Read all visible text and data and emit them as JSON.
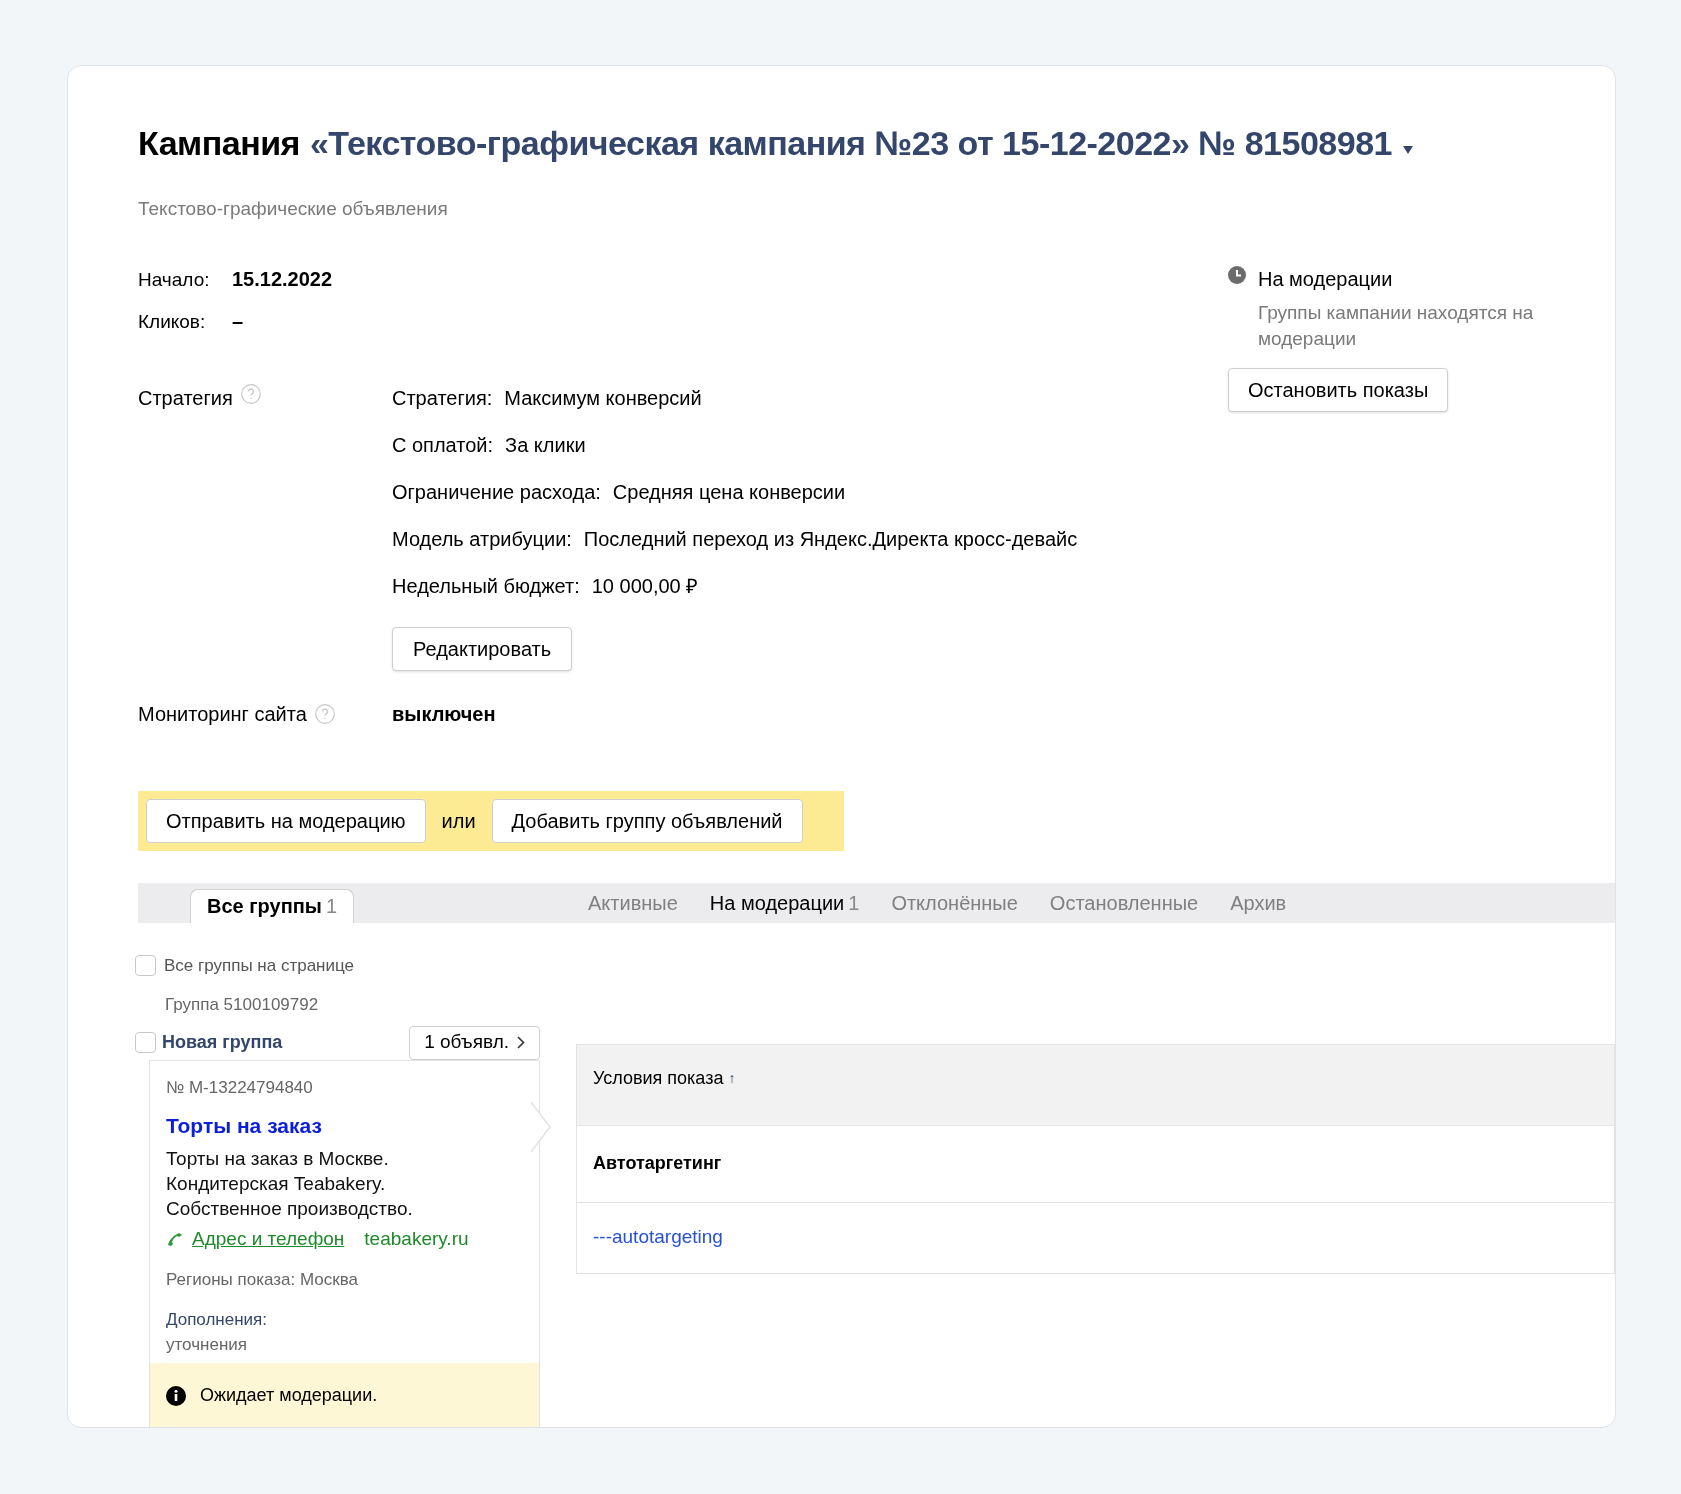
{
  "header": {
    "title_prefix": "Кампания",
    "title_name": "«Текстово-графическая кампания №23 от 15-12-2022» № 81508981",
    "subtitle": "Текстово-графические объявления"
  },
  "facts": [
    {
      "label": "Начало:",
      "value": "15.12.2022"
    },
    {
      "label": "Кликов:",
      "value": "–"
    }
  ],
  "status": {
    "title": "На модерации",
    "description": "Группы кампании находятся на модерации",
    "button": "Остановить показы"
  },
  "strategy": {
    "label": "Стратегия",
    "rows": [
      {
        "label": "Стратегия:",
        "value": "Максимум конверсий"
      },
      {
        "label": "С оплатой:",
        "value": "За клики"
      },
      {
        "label": "Ограничение расхода:",
        "value": "Средняя цена конверсии"
      },
      {
        "label": "Модель атрибуции:",
        "value": "Последний переход из Яндекс.Директа кросс-девайс"
      },
      {
        "label": "Недельный бюджет:",
        "value": "10 000,00 ₽"
      }
    ],
    "edit_button": "Редактировать"
  },
  "monitoring": {
    "label": "Мониторинг сайта",
    "value": "выключен"
  },
  "action_bar": {
    "send_button": "Отправить на модерацию",
    "or": "или",
    "add_button": "Добавить группу объявлений"
  },
  "tabs": [
    {
      "label": "Все группы",
      "count": "1",
      "selected": true
    },
    {
      "label": "Активные",
      "selected": false
    },
    {
      "label": "На модерации",
      "count": "1",
      "selected": false
    },
    {
      "label": "Отклонённые",
      "selected": false
    },
    {
      "label": "Остановленные",
      "selected": false
    },
    {
      "label": "Архив",
      "selected": false
    }
  ],
  "select_all": {
    "label": "Все группы на странице",
    "checked": false
  },
  "group": {
    "id_label": "Группа 5100109792",
    "name": "Новая группа",
    "checked": false,
    "ads_button": "1 объявл.",
    "ad": {
      "number": "№ M-13224794840",
      "title": "Торты на заказ",
      "text": "Торты на заказ в Москве. Кондитерская Teabakery. Собственное производство.",
      "contacts_link": "Адрес и телефон",
      "domain": "teabakery.ru",
      "regions": "Регионы показа: Москва",
      "extras_label": "Дополнения:",
      "extras_value": "уточнения",
      "status": "Ожидает модерации."
    }
  },
  "conditions_table": {
    "column": "Условия показа",
    "sort_arrow": "↑",
    "group_row": "Автотаргетинг",
    "rows": [
      "---autotargeting"
    ]
  }
}
